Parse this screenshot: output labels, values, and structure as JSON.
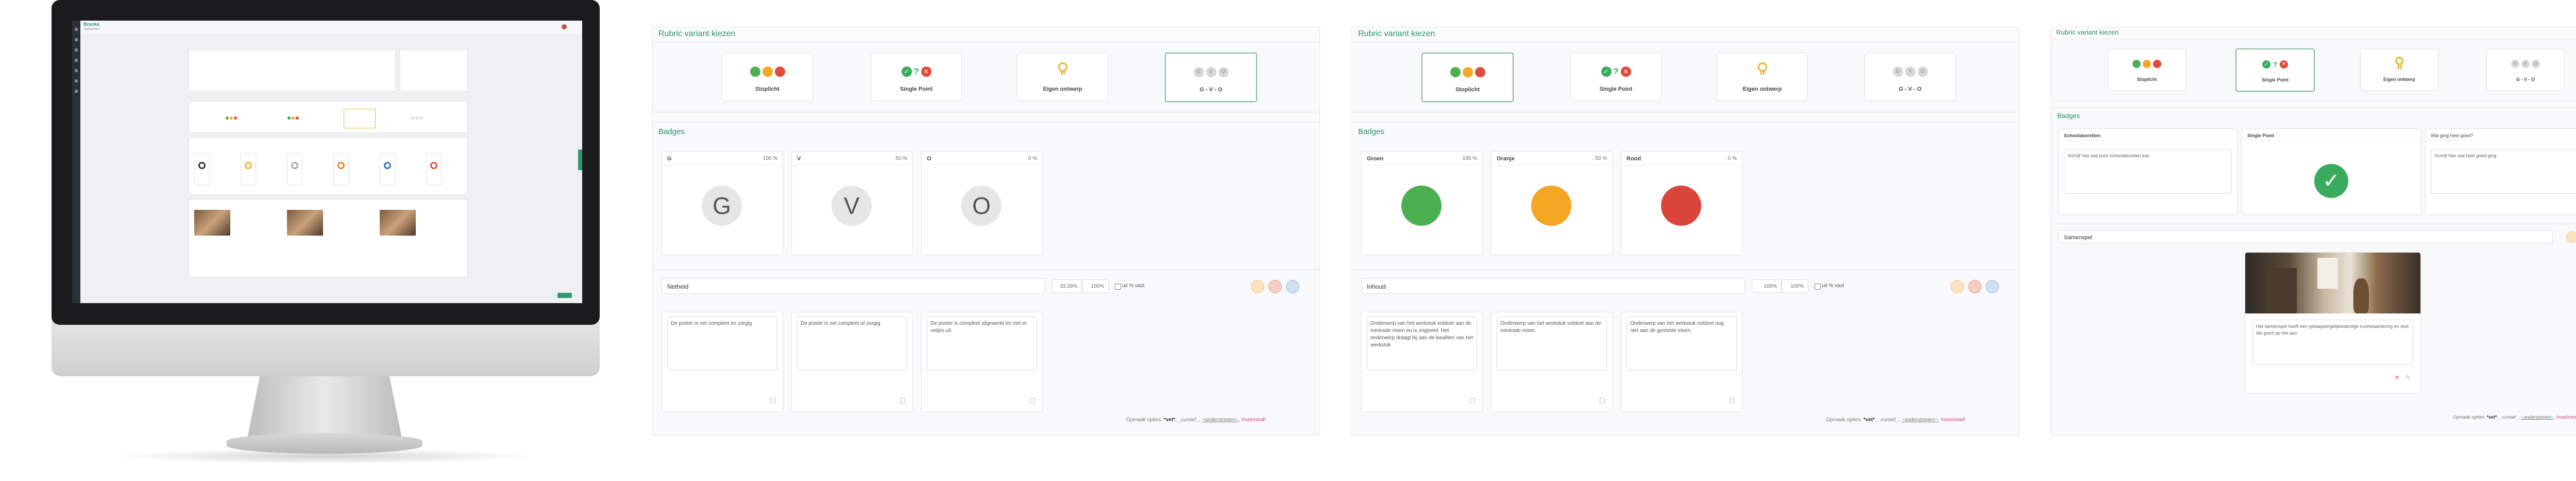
{
  "mini_app": {
    "brand": "Brucka",
    "breadcrumb": "Opdrachten"
  },
  "panel1": {
    "rubric_title": "Rubric variant kiezen",
    "variants": [
      {
        "label": "Stoplicht",
        "icon": "traffic-light-icon"
      },
      {
        "label": "Single Point",
        "icon": "single-point-icon"
      },
      {
        "label": "Eigen ontwerp",
        "icon": "medal-icon"
      },
      {
        "label": "G - V - O",
        "icon": "gvo-icon"
      }
    ],
    "selected_variant": "G - V - O",
    "badges_title": "Badges",
    "badges": [
      {
        "name": "G",
        "percent": "100 %",
        "letter": "G"
      },
      {
        "name": "V",
        "percent": "50 %",
        "letter": "V"
      },
      {
        "name": "O",
        "percent": "0 %",
        "letter": "O"
      }
    ],
    "criterion": {
      "name": "Netheid",
      "weight": "33,33%",
      "max": "100%",
      "checkbox_label": "uit % vast"
    },
    "descriptions": [
      "De poster is net compleet en zorgig",
      "De poster is net compleet of zorgig",
      "De poster is compleet afgewerkt en niet er netjes uit"
    ],
    "hint": {
      "prefix": "Opmaak opties:",
      "bold": "*vet*",
      "italic": "_cursief_",
      "under": "~onderstrepen~",
      "pink": "!roze/rood!"
    }
  },
  "panel2": {
    "rubric_title": "Rubric variant kiezen",
    "variants": [
      {
        "label": "Stoplicht",
        "icon": "traffic-light-icon"
      },
      {
        "label": "Single Point",
        "icon": "single-point-icon"
      },
      {
        "label": "Eigen ontwerp",
        "icon": "medal-icon"
      },
      {
        "label": "G - V - O",
        "icon": "gvo-icon"
      }
    ],
    "selected_variant": "Stoplicht",
    "badges_title": "Badges",
    "badges": [
      {
        "name": "Groen",
        "percent": "100 %",
        "color": "#4caf50"
      },
      {
        "name": "Oranje",
        "percent": "50 %",
        "color": "#f5a623"
      },
      {
        "name": "Rood",
        "percent": "0 %",
        "color": "#e04a3f"
      }
    ],
    "criterion": {
      "name": "Inhoud",
      "weight": "100%",
      "max": "100%",
      "checkbox_label": "uit % vast"
    },
    "descriptions": [
      "Onderwerp van het werkstuk voldoet aan de minimale eisen en is origineel. Het onderwerp draagt bij aan de kwaliten van het werkstuk",
      "Onderwerp van het werkstuk voldoet aan de minimale eisen.",
      "Onderwerp van het werkstuk voldoet nog niet aan de gestelde eisen."
    ],
    "hint": {
      "prefix": "Opmaak opties:",
      "bold": "*vet*",
      "italic": "_cursief_",
      "under": "~onderstrepen~",
      "pink": "!roze/rood!"
    }
  },
  "panel3": {
    "rubric_title": "Rubric variant kiezen",
    "variants": [
      {
        "label": "Stoplicht",
        "icon": "traffic-light-icon"
      },
      {
        "label": "Single Point",
        "icon": "single-point-icon"
      },
      {
        "label": "Eigen ontwerp",
        "icon": "medal-icon"
      },
      {
        "label": "G - V - O",
        "icon": "gvo-icon"
      }
    ],
    "selected_variant": "Single Point",
    "badges_title": "Badges",
    "columns": [
      {
        "header": "Schoolaboretten",
        "body": "Schrijf hier wat kunt schoolaboreten kan"
      },
      {
        "header": "Single Point",
        "body": ""
      },
      {
        "header": "Wat ging heel goed?",
        "body": "Schrijf hier wat heel goed ging"
      }
    ],
    "criterion": {
      "name": "Samenspel"
    },
    "example_text": "Het samenspel heeft een gelaagde/gelijkwaardige inzetwaardering en sluit die goed op het aan",
    "hint": {
      "prefix": "Opmaak opties:",
      "bold": "*vet*",
      "italic": "_cursief_",
      "under": "~onderstrepen~",
      "pink": "!roze/rood!"
    }
  },
  "colors": {
    "accent": "#2f8f6f",
    "green": "#4caf50",
    "orange": "#f5a623",
    "red": "#e04a3f",
    "pink": "#d4357a"
  }
}
